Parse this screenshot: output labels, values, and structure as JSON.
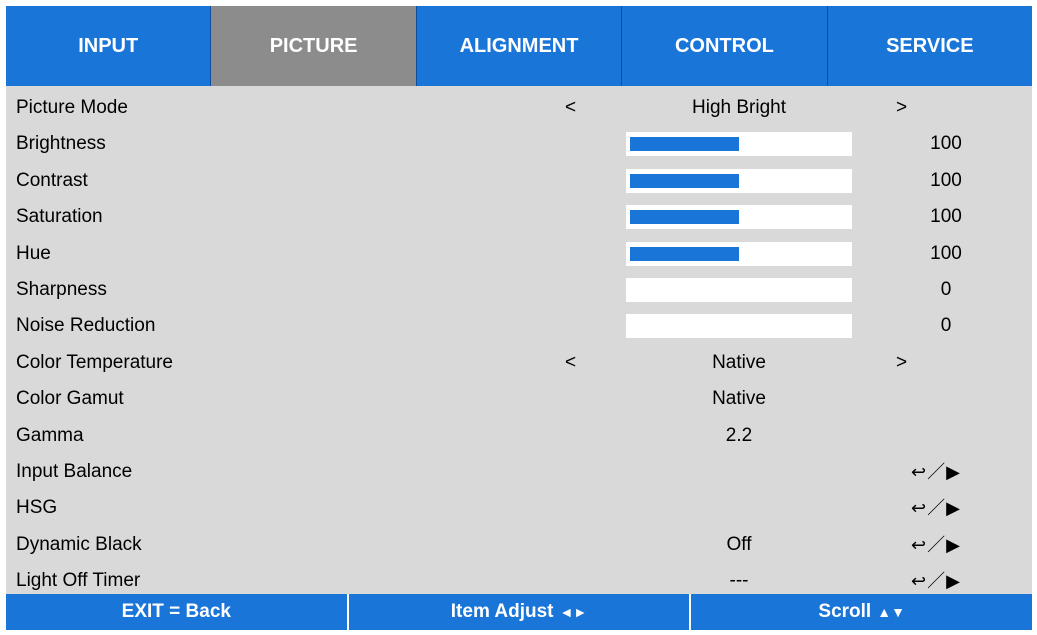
{
  "tabs": [
    {
      "label": "INPUT",
      "active": false
    },
    {
      "label": "PICTURE",
      "active": true
    },
    {
      "label": "ALIGNMENT",
      "active": false
    },
    {
      "label": "CONTROL",
      "active": false
    },
    {
      "label": "SERVICE",
      "active": false
    }
  ],
  "rows": [
    {
      "label": "Picture Mode",
      "type": "select",
      "value": "High Bright",
      "prev": "<",
      "next": ">"
    },
    {
      "label": "Brightness",
      "type": "slider",
      "value": "100",
      "level": 0.5
    },
    {
      "label": "Contrast",
      "type": "slider",
      "value": "100",
      "level": 0.5
    },
    {
      "label": "Saturation",
      "type": "slider",
      "value": "100",
      "level": 0.5
    },
    {
      "label": "Hue",
      "type": "slider",
      "value": "100",
      "level": 0.5
    },
    {
      "label": "Sharpness",
      "type": "slider",
      "value": "0",
      "level": 0
    },
    {
      "label": "Noise Reduction",
      "type": "slider",
      "value": "0",
      "level": 0
    },
    {
      "label": "Color Temperature",
      "type": "select",
      "value": "Native",
      "prev": "<",
      "next": ">"
    },
    {
      "label": "Color Gamut",
      "type": "value",
      "value": "Native"
    },
    {
      "label": "Gamma",
      "type": "value",
      "value": "2.2"
    },
    {
      "label": "Input Balance",
      "type": "submenu",
      "value": "",
      "enter": "↩／▶"
    },
    {
      "label": "HSG",
      "type": "submenu",
      "value": "",
      "enter": "↩／▶"
    },
    {
      "label": "Dynamic Black",
      "type": "submenu",
      "value": "Off",
      "enter": "↩／▶"
    },
    {
      "label": "Light Off Timer",
      "type": "submenu",
      "value": "---",
      "enter": "↩／▶"
    }
  ],
  "footer": {
    "exit": "EXIT = Back",
    "adjust": "Item Adjust",
    "adjust_arrows": "◄►",
    "scroll": "Scroll",
    "scroll_arrows": "▲▼"
  },
  "colors": {
    "accent": "#1a75d9",
    "active_tab": "#8c8c8c",
    "panel": "#d9d9d9"
  }
}
